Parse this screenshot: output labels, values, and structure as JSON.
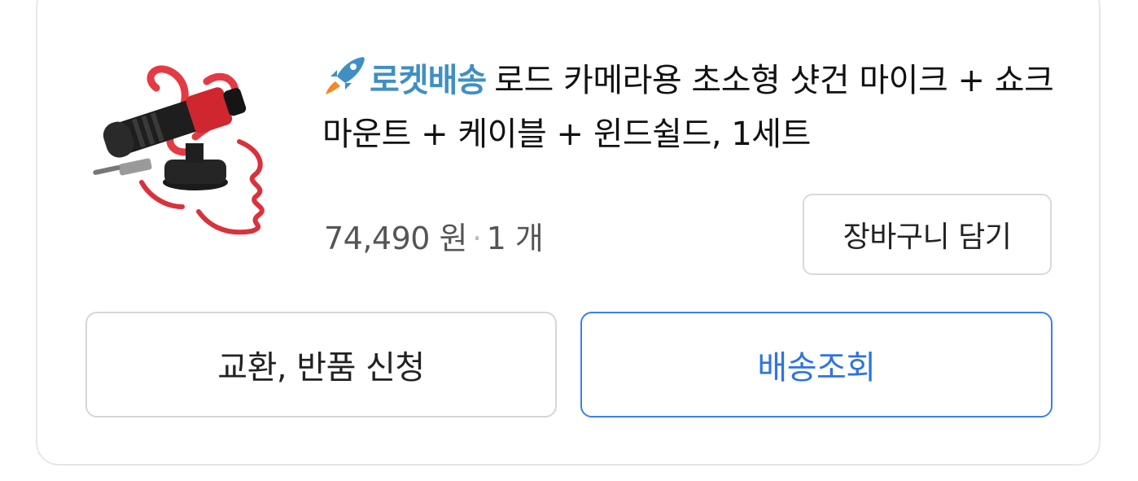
{
  "product": {
    "badge_label": "로켓배송",
    "badge_icon": "rocket-icon",
    "title": "로드 카메라용 초소형 샷건 마이크 + 쇼크마운트 + 케이블 + 윈드쉴드, 1세트",
    "price": "74,490 원",
    "separator": "·",
    "quantity": "1 개",
    "image_subject": "microphone-product-image"
  },
  "actions": {
    "cart_label": "장바구니 담기",
    "return_label": "교환, 반품 신청",
    "track_label": "배송조회"
  },
  "colors": {
    "badge": "#3f8fc4",
    "track_button": "#2f73e0",
    "border": "#d6d6d6"
  }
}
